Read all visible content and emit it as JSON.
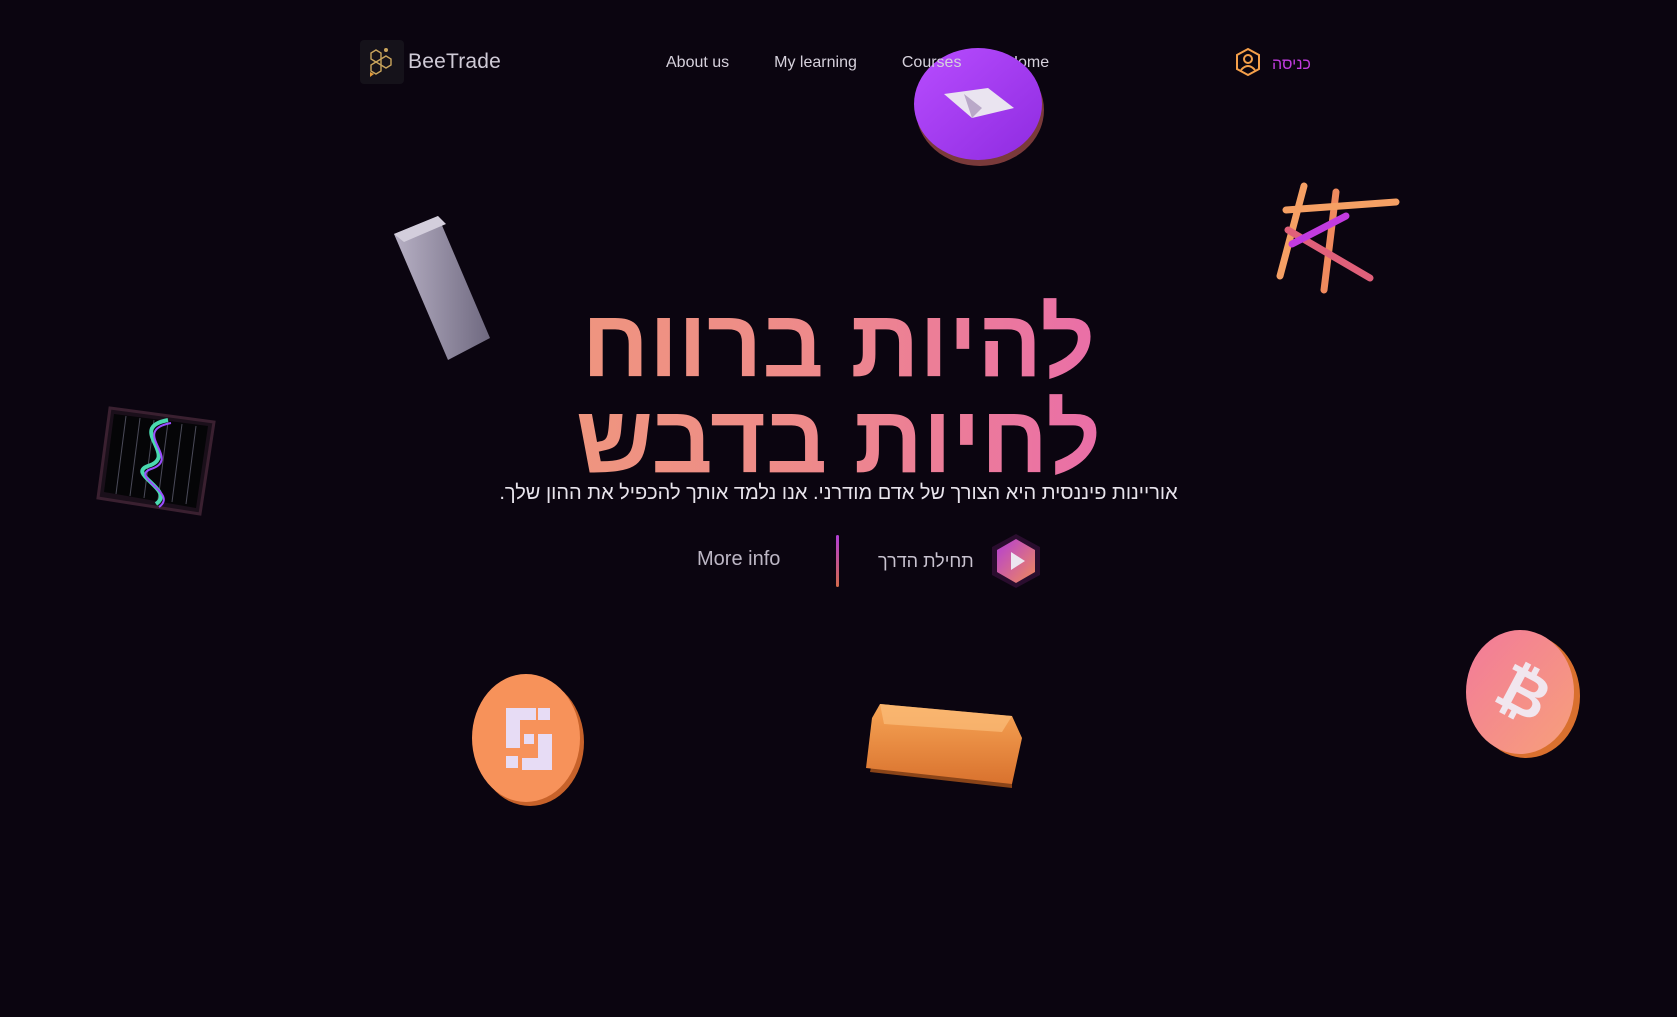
{
  "header": {
    "brand": "BeeTrade",
    "nav": [
      {
        "label": "About us"
      },
      {
        "label": "My learning"
      },
      {
        "label": "Courses"
      },
      {
        "label": "Home"
      }
    ],
    "login_label": "כניסה"
  },
  "hero": {
    "headline_line1": "להיות ברווח",
    "headline_line2": "לחיות בדבש",
    "subtitle": "אוריינות פיננסית היא הצורך של אדם מודרני. אנו נלמד אותך להכפיל את ההון שלך.",
    "more_info_label": "More info",
    "start_guide_label": "תחילת הדרך"
  },
  "colors": {
    "background": "#0b0510",
    "accent_orange": "#f5a04a",
    "accent_purple": "#c23be0",
    "gradient_start": "#f2b262",
    "gradient_end": "#e238e2"
  },
  "icons": {
    "logo": "honeycomb-logo-icon",
    "login": "user-hexagon-icon",
    "play": "play-hexagon-icon"
  }
}
